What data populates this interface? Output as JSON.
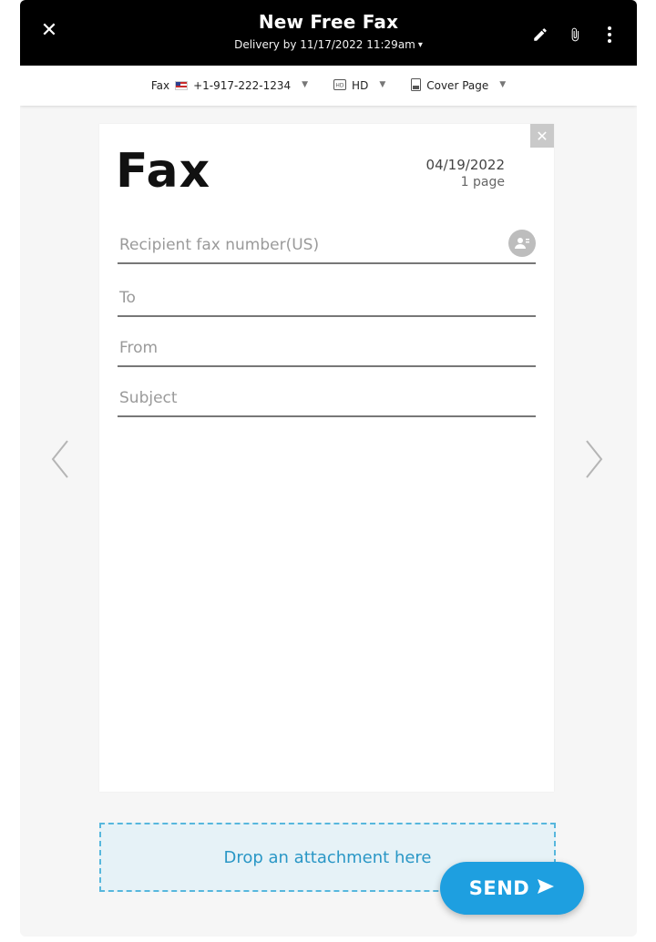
{
  "header": {
    "title": "New Free Fax",
    "delivery": "Delivery by 11/17/2022 11:29am"
  },
  "toolbar": {
    "fax_prefix": "Fax",
    "fax_number": "+1-917-222-1234",
    "quality": "HD",
    "cover_page": "Cover Page"
  },
  "sheet": {
    "heading": "Fax",
    "date": "04/19/2022",
    "pages": "1 page",
    "fields": {
      "recipient_placeholder": "Recipient fax number(US)",
      "to_placeholder": "To",
      "from_placeholder": "From",
      "subject_placeholder": "Subject"
    }
  },
  "dropzone": {
    "text": "Drop an attachment here"
  },
  "send": {
    "label": "SEND"
  },
  "colors": {
    "header_bg": "#000000",
    "accent": "#1e9fe0",
    "drop_bg": "#e6f2f7",
    "drop_border": "#57b7dd"
  },
  "icons": {
    "close": "close-icon",
    "pencil": "pencil-icon",
    "attach": "paperclip-icon",
    "more": "more-vertical-icon",
    "flag": "us-flag-icon",
    "hd": "hd-icon",
    "cover": "cover-page-icon",
    "contacts": "contacts-icon",
    "prev": "chevron-left-icon",
    "next": "chevron-right-icon",
    "send": "send-arrow-icon"
  }
}
